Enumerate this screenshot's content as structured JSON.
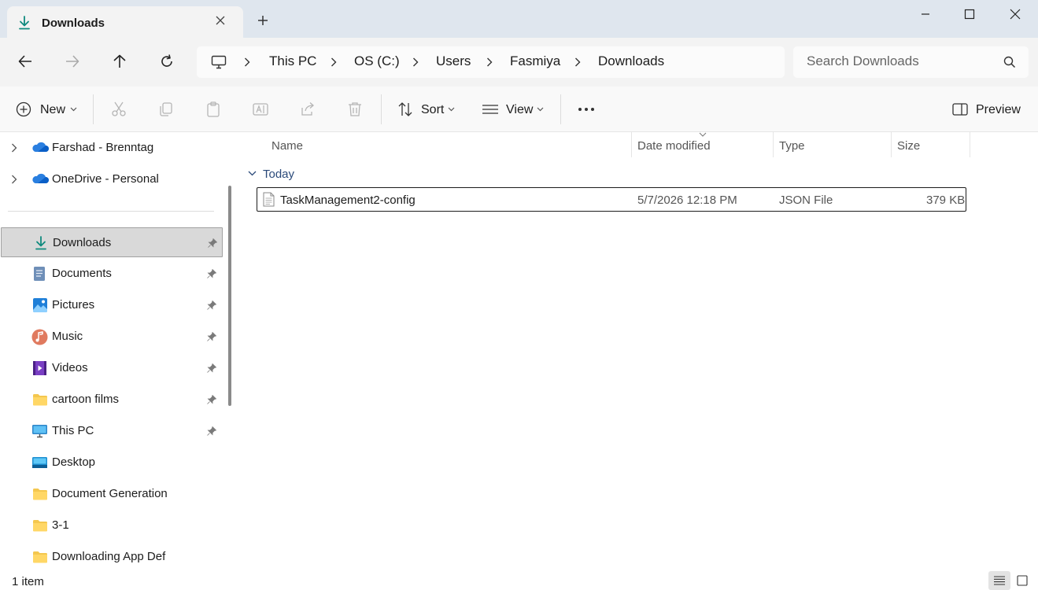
{
  "window": {
    "tab_title": "Downloads",
    "tab_icon": "download-arrow-icon",
    "accent_color": "#0f8a7e"
  },
  "address": {
    "crumbs": [
      "This PC",
      "OS (C:)",
      "Users",
      "Fasmiya",
      "Downloads"
    ]
  },
  "search": {
    "placeholder": "Search Downloads"
  },
  "toolbar": {
    "new_label": "New",
    "sort_label": "Sort",
    "view_label": "View",
    "preview_label": "Preview"
  },
  "sidebar": {
    "cloud": [
      {
        "label": "Farshad - Brenntag",
        "icon": "onedrive-cloud-icon"
      },
      {
        "label": "OneDrive - Personal",
        "icon": "onedrive-cloud-icon"
      }
    ],
    "quick_access": [
      {
        "label": "Downloads",
        "icon": "downloads-icon",
        "pinned": true,
        "selected": true
      },
      {
        "label": "Documents",
        "icon": "documents-icon",
        "pinned": true
      },
      {
        "label": "Pictures",
        "icon": "pictures-icon",
        "pinned": true
      },
      {
        "label": "Music",
        "icon": "music-icon",
        "pinned": true
      },
      {
        "label": "Videos",
        "icon": "videos-icon",
        "pinned": true
      },
      {
        "label": "cartoon films",
        "icon": "folder-icon",
        "pinned": true
      },
      {
        "label": "This PC",
        "icon": "monitor-icon",
        "pinned": true
      },
      {
        "label": "Desktop",
        "icon": "desktop-icon",
        "pinned": false
      },
      {
        "label": "Document Generation",
        "icon": "folder-icon",
        "pinned": false
      },
      {
        "label": "3-1",
        "icon": "folder-icon",
        "pinned": false
      },
      {
        "label": "Downloading App Def",
        "icon": "folder-icon",
        "pinned": false
      }
    ]
  },
  "columns": {
    "name": "Name",
    "date_modified": "Date modified",
    "type": "Type",
    "size": "Size"
  },
  "groups": [
    {
      "label": "Today",
      "files": [
        {
          "name": "TaskManagement2-config",
          "date_modified": "5/7/2026 12:18 PM",
          "type": "JSON File",
          "size": "379 KB"
        }
      ]
    }
  ],
  "status": {
    "item_count": "1 item"
  }
}
